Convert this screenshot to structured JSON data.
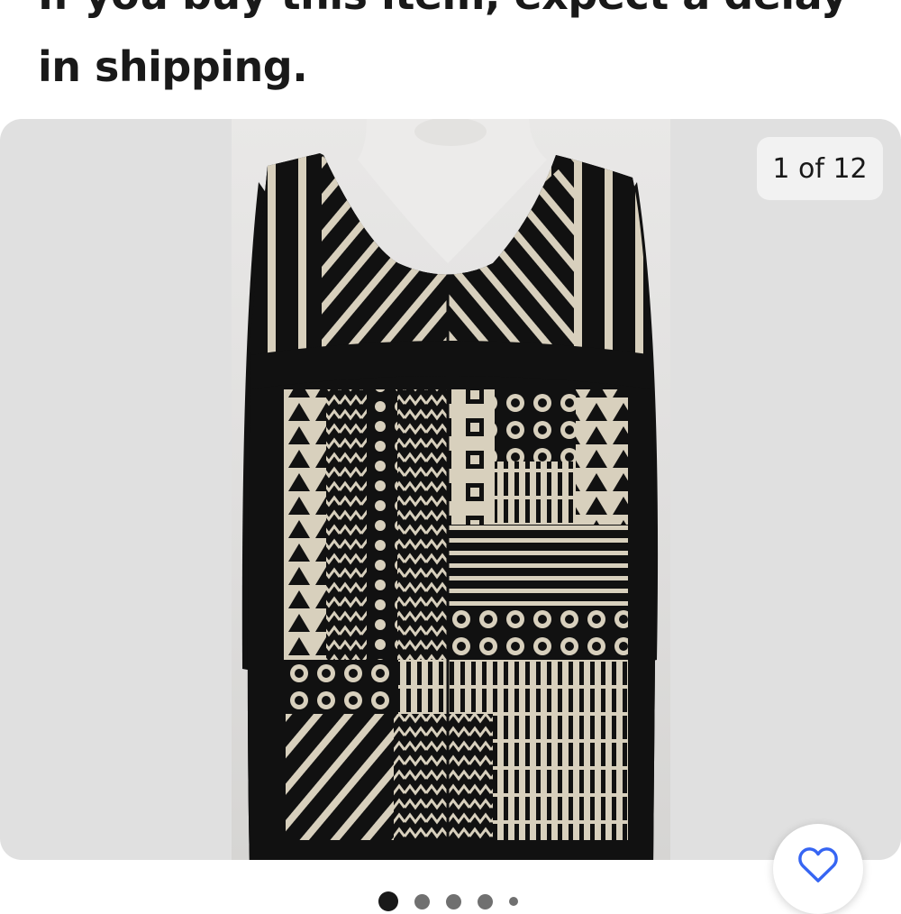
{
  "listing": {
    "shipping_notice": "If you buy this item, expect a delay in shipping."
  },
  "gallery": {
    "counter": "1 of 12",
    "current_image": 1,
    "total_images": 12,
    "image_alt": "Black and cream tribal print long sleeve v-neck tunic top on mannequin",
    "colors": {
      "background": "#e0e0e0",
      "garment": "#111111",
      "print": "#d8d0bd"
    }
  },
  "actions": {
    "favorite_icon": "heart-outline-icon"
  }
}
